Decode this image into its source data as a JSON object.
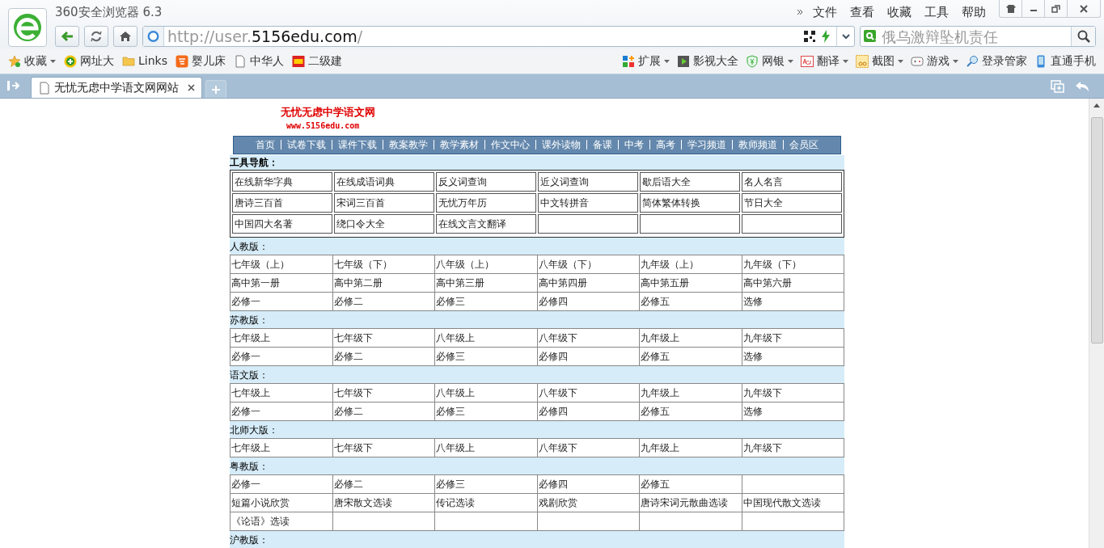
{
  "browser": {
    "title": "360安全浏览器 6.3",
    "menu": [
      "文件",
      "查看",
      "收藏",
      "工具",
      "帮助"
    ],
    "url": {
      "prefix": "http://user.",
      "domain": "5156edu.com",
      "suffix": "/"
    },
    "search_placeholder": "俄乌激辩坠机责任",
    "bookmarks": [
      {
        "label": "收藏",
        "menu": true
      },
      {
        "label": "网址大",
        "menu": false
      },
      {
        "label": "Links",
        "menu": false
      },
      {
        "label": "婴儿床",
        "menu": false
      },
      {
        "label": "中华人",
        "menu": false
      },
      {
        "label": "二级建",
        "menu": false
      }
    ],
    "tools": [
      {
        "label": "扩展",
        "menu": true
      },
      {
        "label": "影视大全",
        "menu": false
      },
      {
        "label": "网银",
        "menu": true
      },
      {
        "label": "翻译",
        "menu": true
      },
      {
        "label": "截图",
        "menu": true
      },
      {
        "label": "游戏",
        "menu": true
      },
      {
        "label": "登录管家",
        "menu": false
      },
      {
        "label": "直通手机",
        "menu": false
      }
    ],
    "tabs": [
      {
        "title": "无忧无虑中学语文网网站",
        "selected": true
      }
    ]
  },
  "page": {
    "site_title": "无忧无虑中学语文网",
    "site_url": "www.5156edu.com",
    "nav": [
      "首页",
      "试卷下载",
      "课件下载",
      "教案教学",
      "教学素材",
      "作文中心",
      "课外读物",
      "备课",
      "中考",
      "高考",
      "学习频道",
      "教师频道",
      "会员区"
    ],
    "tools_heading": "工具导航：",
    "tools": [
      [
        "在线新华字典",
        "在线成语词典",
        "反义词查询",
        "近义词查询",
        "歇后语大全",
        "名人名言"
      ],
      [
        "唐诗三百首",
        "宋词三百首",
        "无忧万年历",
        "中文转拼音",
        "简体繁体转换",
        "节日大全"
      ],
      [
        "中国四大名著",
        "绕口令大全",
        "在线文言文翻译"
      ]
    ],
    "sections": [
      {
        "heading": "人教版：",
        "rows": [
          [
            "七年级（上）",
            "七年级（下）",
            "八年级（上）",
            "八年级（下）",
            "九年级（上）",
            "九年级（下）"
          ],
          [
            "高中第一册",
            "高中第二册",
            "高中第三册",
            "高中第四册",
            "高中第五册",
            "高中第六册"
          ],
          [
            "必修一",
            "必修二",
            "必修三",
            "必修四",
            "必修五",
            "选修"
          ]
        ]
      },
      {
        "heading": "苏教版：",
        "rows": [
          [
            "七年级上",
            "七年级下",
            "八年级上",
            "八年级下",
            "九年级上",
            "九年级下"
          ],
          [
            "必修一",
            "必修二",
            "必修三",
            "必修四",
            "必修五",
            "选修"
          ]
        ]
      },
      {
        "heading": "语文版：",
        "rows": [
          [
            "七年级上",
            "七年级下",
            "八年级上",
            "八年级下",
            "九年级上",
            "九年级下"
          ],
          [
            "必修一",
            "必修二",
            "必修三",
            "必修四",
            "必修五",
            "选修"
          ]
        ]
      },
      {
        "heading": "北师大版：",
        "rows": [
          [
            "七年级上",
            "七年级下",
            "八年级上",
            "八年级下",
            "九年级上",
            "九年级下"
          ]
        ]
      },
      {
        "heading": "粤教版：",
        "rows": [
          [
            "必修一",
            "必修二",
            "必修三",
            "必修四",
            "必修五"
          ],
          [
            "短篇小说欣赏",
            "唐宋散文选读",
            "传记选读",
            "戏剧欣赏",
            "唐诗宋词元散曲选读",
            "中国现代散文选读"
          ],
          [
            "《论语》选读"
          ]
        ]
      },
      {
        "heading": "沪教版："
      }
    ]
  }
}
